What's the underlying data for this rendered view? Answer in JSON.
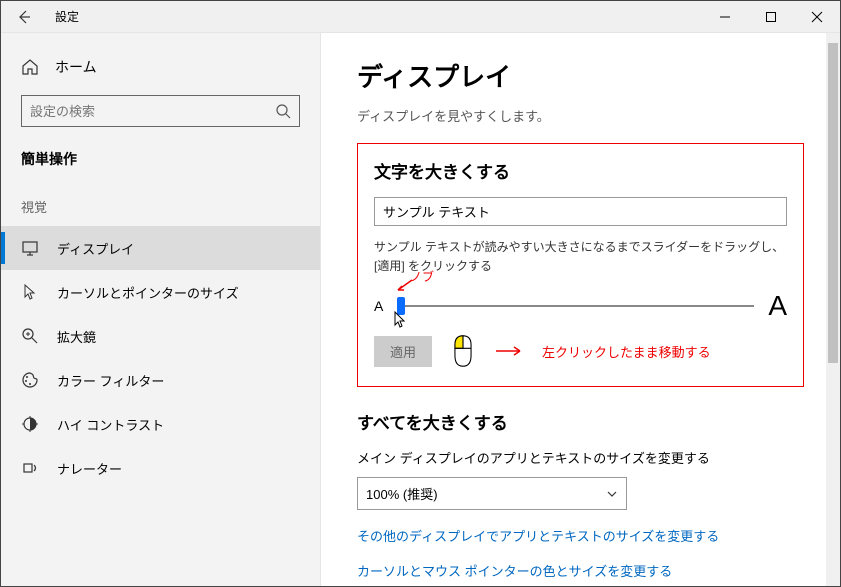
{
  "titlebar": {
    "title": "設定"
  },
  "sidebar": {
    "home": "ホーム",
    "search_placeholder": "設定の検索",
    "section": "簡単操作",
    "group_visual": "視覚",
    "items": [
      {
        "label": "ディスプレイ"
      },
      {
        "label": "カーソルとポインターのサイズ"
      },
      {
        "label": "拡大鏡"
      },
      {
        "label": "カラー フィルター"
      },
      {
        "label": "ハイ コントラスト"
      },
      {
        "label": "ナレーター"
      }
    ]
  },
  "page": {
    "title": "ディスプレイ",
    "subtitle": "ディスプレイを見やすくします。"
  },
  "text_size": {
    "heading": "文字を大きくする",
    "sample": "サンプル テキスト",
    "helper": "サンプル テキストが読みやすい大きさになるまでスライダーをドラッグし、[適用] をクリックする",
    "small_a": "A",
    "big_a": "A",
    "apply": "適用"
  },
  "annotations": {
    "knob": "ノブ",
    "drag": "左クリックしたまま移動する"
  },
  "scale": {
    "heading": "すべてを大きくする",
    "label": "メイン ディスプレイのアプリとテキストのサイズを変更する",
    "selected": "100% (推奨)"
  },
  "links": {
    "other_displays": "その他のディスプレイでアプリとテキストのサイズを変更する",
    "cursor_color": "カーソルとマウス ポインターの色とサイズを変更する"
  }
}
